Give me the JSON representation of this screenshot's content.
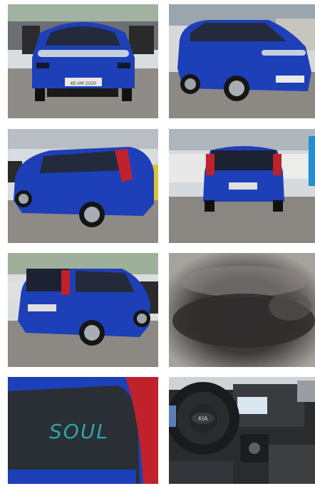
{
  "gallery": {
    "photos": [
      {
        "label": "front"
      },
      {
        "label": "front-three-quarter"
      },
      {
        "label": "rear-three-quarter-left"
      },
      {
        "label": "rear"
      },
      {
        "label": "rear-three-quarter-left-2"
      },
      {
        "label": "blurred-placeholder"
      },
      {
        "label": "soul-badge-detail"
      },
      {
        "label": "interior-dashboard"
      }
    ],
    "badge_text": "SOUL",
    "plate_text": "KE-VM 2020",
    "steering_logo": "KIA"
  },
  "colors": {
    "car_blue": "#1d3fb8",
    "badge_teal": "#2ea3a8",
    "tail_red": "#c0222b"
  }
}
